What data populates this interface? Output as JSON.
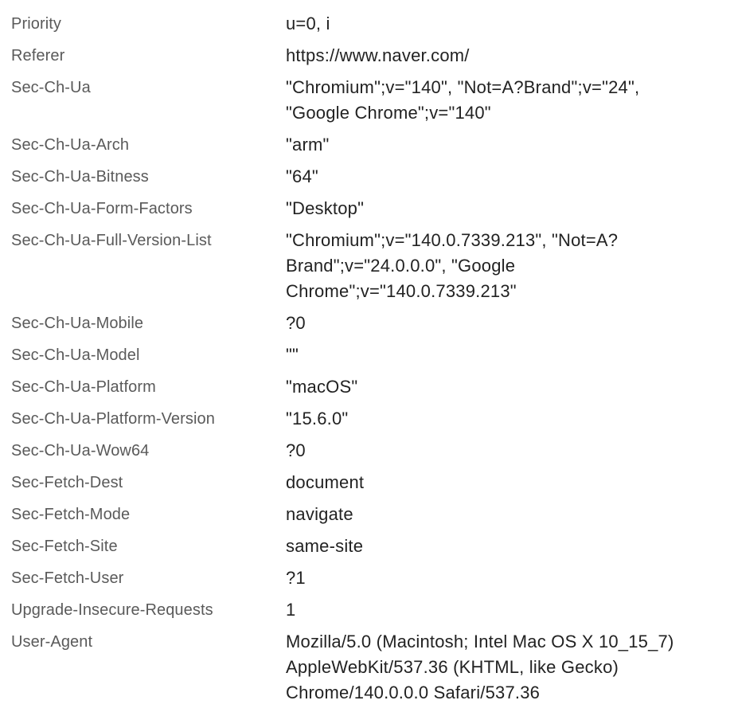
{
  "headers": [
    {
      "name": "Priority",
      "value": "u=0, i"
    },
    {
      "name": "Referer",
      "value": "https://www.naver.com/"
    },
    {
      "name": "Sec-Ch-Ua",
      "value": "\"Chromium\";v=\"140\", \"Not=A?Brand\";v=\"24\", \"Google Chrome\";v=\"140\""
    },
    {
      "name": "Sec-Ch-Ua-Arch",
      "value": "\"arm\""
    },
    {
      "name": "Sec-Ch-Ua-Bitness",
      "value": "\"64\""
    },
    {
      "name": "Sec-Ch-Ua-Form-Factors",
      "value": "\"Desktop\""
    },
    {
      "name": "Sec-Ch-Ua-Full-Version-List",
      "value": "\"Chromium\";v=\"140.0.7339.213\", \"Not=A?Brand\";v=\"24.0.0.0\", \"Google Chrome\";v=\"140.0.7339.213\""
    },
    {
      "name": "Sec-Ch-Ua-Mobile",
      "value": "?0"
    },
    {
      "name": "Sec-Ch-Ua-Model",
      "value": "\"\""
    },
    {
      "name": "Sec-Ch-Ua-Platform",
      "value": "\"macOS\""
    },
    {
      "name": "Sec-Ch-Ua-Platform-Version",
      "value": "\"15.6.0\""
    },
    {
      "name": "Sec-Ch-Ua-Wow64",
      "value": "?0"
    },
    {
      "name": "Sec-Fetch-Dest",
      "value": "document"
    },
    {
      "name": "Sec-Fetch-Mode",
      "value": "navigate"
    },
    {
      "name": "Sec-Fetch-Site",
      "value": "same-site"
    },
    {
      "name": "Sec-Fetch-User",
      "value": "?1"
    },
    {
      "name": "Upgrade-Insecure-Requests",
      "value": "1"
    },
    {
      "name": "User-Agent",
      "value": "Mozilla/5.0 (Macintosh; Intel Mac OS X 10_15_7) AppleWebKit/537.36 (KHTML, like Gecko) Chrome/140.0.0.0 Safari/537.36"
    }
  ]
}
